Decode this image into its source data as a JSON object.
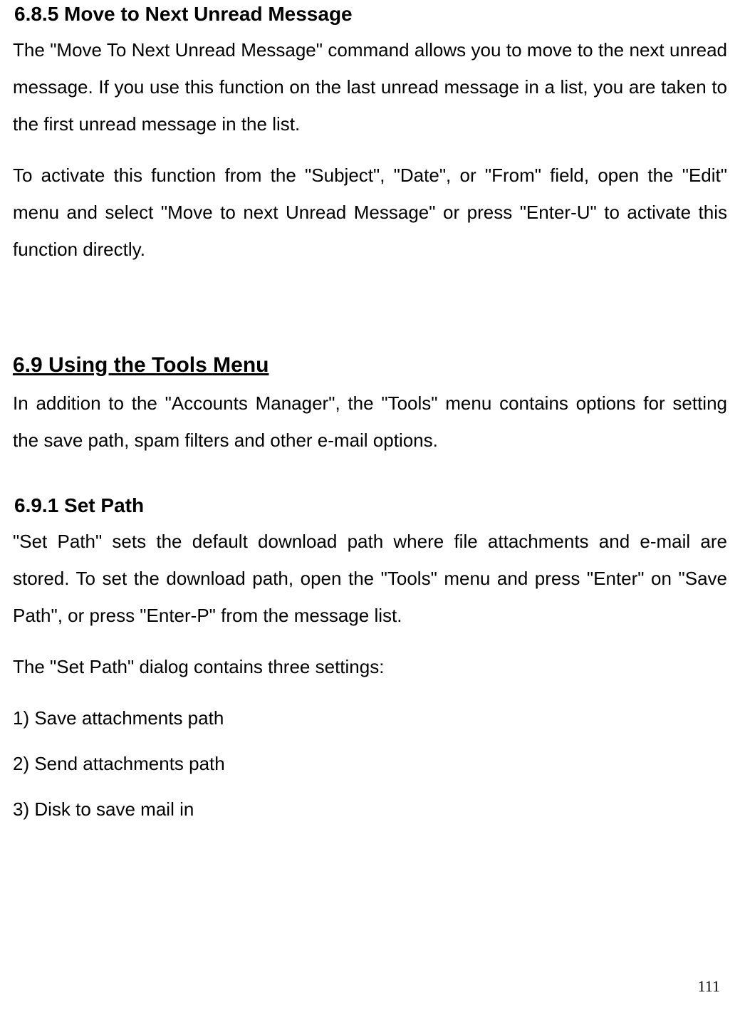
{
  "section_6_8_5": {
    "heading": "6.8.5 Move to Next Unread Message",
    "para1": "The \"Move To Next Unread Message\" command allows you to move to the next unread message. If you use this function on the last unread message in a list, you are taken to the first unread message in the list.",
    "para2": "To activate this function from the \"Subject\", \"Date\", or \"From\" field, open the \"Edit\" menu and select \"Move to next Unread Message\" or press \"Enter-U\" to activate this function directly."
  },
  "section_6_9": {
    "heading": "6.9 Using the Tools Menu",
    "para1": "In addition to the \"Accounts Manager\", the \"Tools\" menu contains options for setting the save path, spam filters and other e-mail options."
  },
  "section_6_9_1": {
    "heading": "6.9.1 Set Path",
    "para1": "\"Set Path\" sets the default download path where file attachments and e-mail are stored. To set the download path, open the \"Tools\" menu and press \"Enter\" on \"Save Path\", or press \"Enter-P\" from the message list.",
    "para2": "The \"Set Path\" dialog contains three settings:",
    "item1": "1) Save attachments path",
    "item2": "2) Send attachments path",
    "item3": "3) Disk to save mail in"
  },
  "page_number": "111"
}
